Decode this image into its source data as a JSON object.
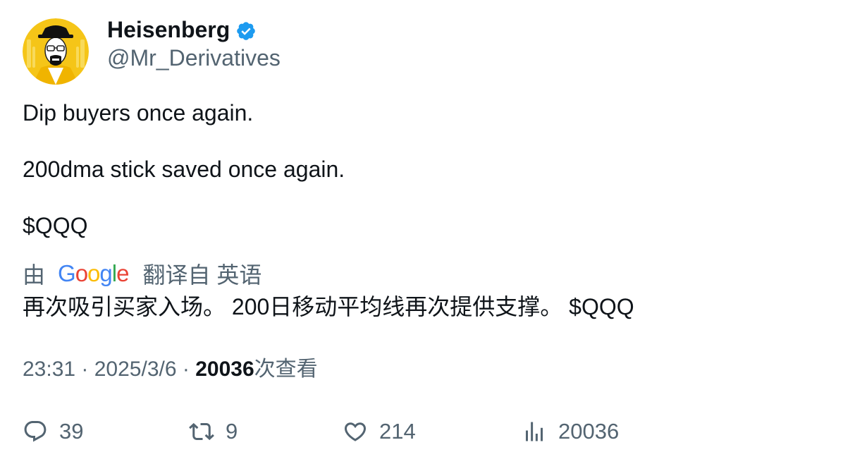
{
  "author": {
    "display_name": "Heisenberg",
    "handle": "@Mr_Derivatives",
    "verified": true,
    "verified_color": "#1d9bf0",
    "avatar_bg": "#f5c518"
  },
  "tweet": {
    "paragraphs": [
      "Dip buyers once again.",
      "200dma stick saved once again.",
      "$QQQ"
    ]
  },
  "translation": {
    "by_label": "由",
    "provider": "Google",
    "from_label": "翻译自 英语",
    "text": "再次吸引买家入场。 200日移动平均线再次提供支撑。 $QQQ"
  },
  "meta": {
    "time": "23:31",
    "separator": " · ",
    "date": "2025/3/6",
    "views_count": "20036",
    "views_label": "次查看"
  },
  "actions": {
    "replies": "39",
    "retweets": "9",
    "likes": "214",
    "views": "20036"
  },
  "colors": {
    "text_primary": "#0f1419",
    "text_secondary": "#536471",
    "google_blue": "#4285f4",
    "google_red": "#ea4335",
    "google_yellow": "#fbbc05",
    "google_green": "#34a853"
  }
}
